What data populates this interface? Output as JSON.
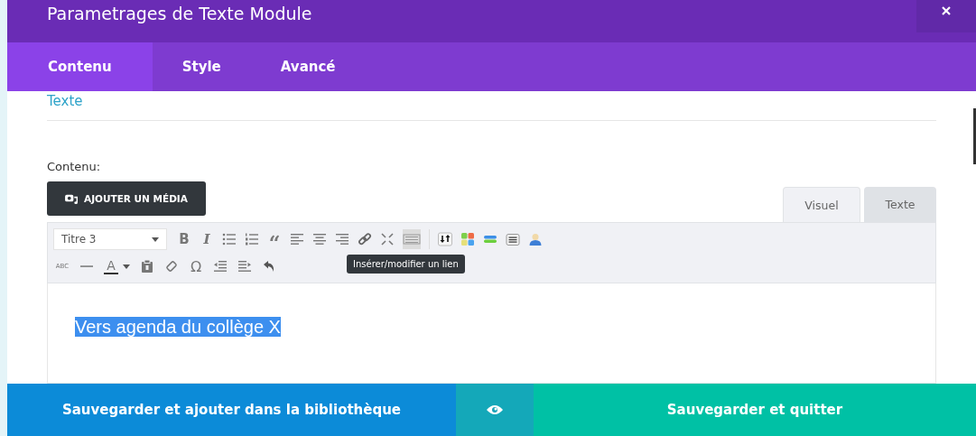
{
  "modal": {
    "title": "Parametrages de Texte Module"
  },
  "tabs": [
    {
      "label": "Contenu",
      "selected": true
    },
    {
      "label": "Style",
      "selected": false
    },
    {
      "label": "Avancé",
      "selected": false
    }
  ],
  "section_heading": "Texte",
  "field_label": "Contenu:",
  "media_button": "AJOUTER UN MÉDIA",
  "editor_tabs": [
    {
      "label": "Visuel",
      "selected": true
    },
    {
      "label": "Texte",
      "selected": false
    }
  ],
  "format_select": {
    "value": "Titre 3"
  },
  "toolbar_row_1": [
    {
      "kind": "bold",
      "label": "B",
      "pressed": false
    },
    {
      "kind": "italic",
      "label": "I",
      "pressed": false
    },
    {
      "kind": "bullets",
      "pressed": false
    },
    {
      "kind": "numbers",
      "pressed": false
    },
    {
      "kind": "quote",
      "label": "“",
      "pressed": false
    },
    {
      "kind": "align-left",
      "pressed": false
    },
    {
      "kind": "align-center",
      "pressed": false
    },
    {
      "kind": "align-right",
      "pressed": false
    },
    {
      "kind": "link",
      "pressed": false
    },
    {
      "kind": "fullscreen",
      "pressed": false
    },
    {
      "kind": "keyboard",
      "pressed": true
    },
    {
      "kind": "sep"
    },
    {
      "kind": "arrows",
      "pressed": false
    },
    {
      "kind": "grid",
      "pressed": false
    },
    {
      "kind": "bars",
      "pressed": false
    },
    {
      "kind": "listbox",
      "pressed": false
    },
    {
      "kind": "person",
      "pressed": false
    }
  ],
  "toolbar_row_2": [
    {
      "kind": "strike",
      "label": "ABC"
    },
    {
      "kind": "hr"
    },
    {
      "kind": "color",
      "label": "A"
    },
    {
      "kind": "paste"
    },
    {
      "kind": "eraser"
    },
    {
      "kind": "glyph",
      "label": "Ω"
    },
    {
      "kind": "outdent"
    },
    {
      "kind": "indent"
    },
    {
      "kind": "undo"
    }
  ],
  "tooltip": "Insérer/modifier un lien",
  "content": {
    "text": "Vers agenda du collège X",
    "selected": true
  },
  "footer": {
    "library_button": "Sauvegarder et ajouter dans la bibliothèque",
    "save_button": "Sauvegarder et quitter"
  }
}
